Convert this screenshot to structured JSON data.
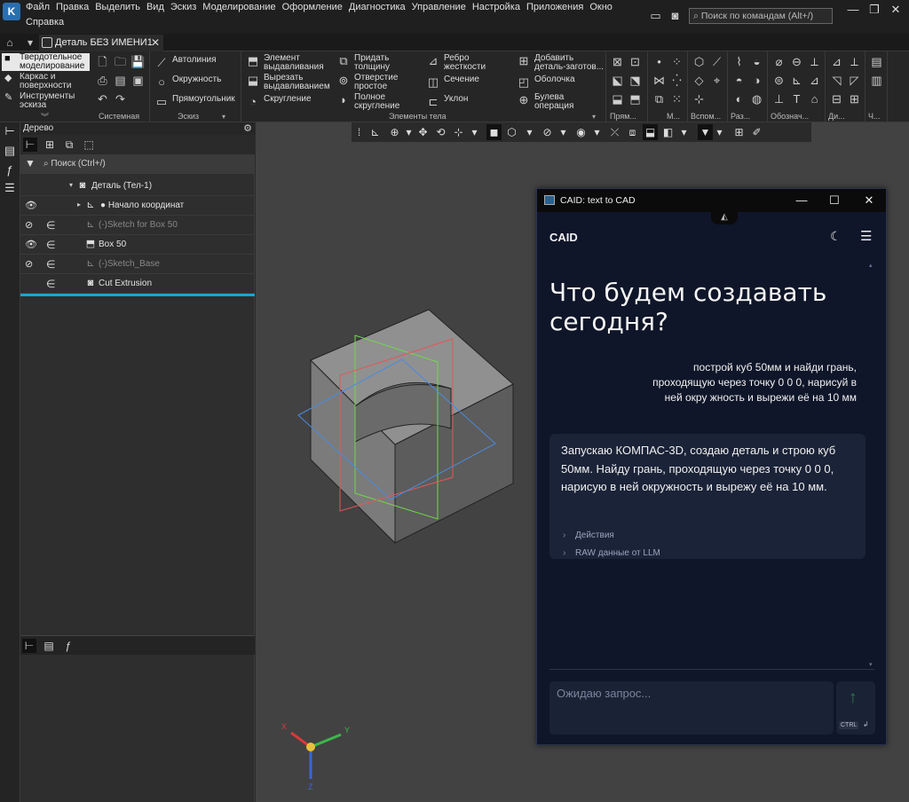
{
  "menubar": {
    "app_logo": "K",
    "items": [
      "Файл",
      "Правка",
      "Выделить",
      "Вид",
      "Эскиз",
      "Моделирование",
      "Оформление",
      "Диагностика",
      "Управление",
      "Настройка",
      "Приложения",
      "Окно",
      "Справка"
    ],
    "command_search_placeholder": "Поиск по командам (Alt+/)",
    "window_controls": [
      "—",
      "❐",
      "✕"
    ]
  },
  "tabbar": {
    "tab_title": "Деталь БЕЗ ИМЕНИ1",
    "close": "✕"
  },
  "ribbon": {
    "modes": [
      "Твердотельное моделирование",
      "Каркас и поверхности",
      "Инструменты эскиза"
    ],
    "groups": {
      "system_label": "Системная",
      "sketch_label": "Эскиз",
      "body_label": "Элементы тела",
      "small_labels": [
        "Прям...",
        "М...",
        "Вспом...",
        "Раз...",
        "Обознач...",
        "Ди...",
        "Ч..."
      ]
    },
    "sketch_buttons": [
      "Автолиния",
      "Окружность",
      "Прямоугольник"
    ],
    "body_buttons": [
      "Элемент выдавливания",
      "Вырезать выдавливанием",
      "Скругление",
      "Придать толщину",
      "Отверстие простое",
      "Полное скругление",
      "Ребро жесткости",
      "Сечение",
      "Уклон",
      "Добавить деталь-заготов...",
      "Оболочка",
      "Булева операция"
    ]
  },
  "tree": {
    "title": "Дерево",
    "search_placeholder": "Поиск (Ctrl+/)",
    "rows": [
      {
        "label": "Деталь (Тел-1)",
        "visible": "",
        "include": ""
      },
      {
        "label": "Начало координат",
        "visible": "👁",
        "include": ""
      },
      {
        "label": "(-)Sketch for Box 50",
        "visible": "⊘",
        "include": "∈"
      },
      {
        "label": "Box 50",
        "visible": "👁",
        "include": "∈"
      },
      {
        "label": "(-)Sketch_Base",
        "visible": "⊘",
        "include": "∈"
      },
      {
        "label": "Cut Extrusion",
        "visible": "",
        "include": "∈"
      }
    ]
  },
  "caid": {
    "window_title": "CAID: text to CAD",
    "brand": "CAID",
    "heading": "Что будем создавать сегодня?",
    "user_message": "построй куб 50мм и найди грань, проходящую через точку 0 0 0, нарисуй в ней окру жность и вырежи её на 10 мм",
    "bot_message": "Запускаю КОМПАС-3D, создаю деталь и строю куб 50мм. Найду грань, проходящую через точку 0 0 0, нарисую в ней окружность и вырежу её на 10 мм.",
    "actions_label": "Действия",
    "raw_label": "RAW данные от LLM",
    "input_placeholder": "Ожидаю запрос...",
    "ctrl_hint": "CTRL",
    "enter_hint": "↲"
  },
  "colors": {
    "accent_tree_separator": "#1aa3d9",
    "caid_background": "#0f1629",
    "caid_card": "#1b2338",
    "send_arrow": "#2f7a4a"
  },
  "axes": {
    "x": "X",
    "y": "Y",
    "z": "Z"
  }
}
